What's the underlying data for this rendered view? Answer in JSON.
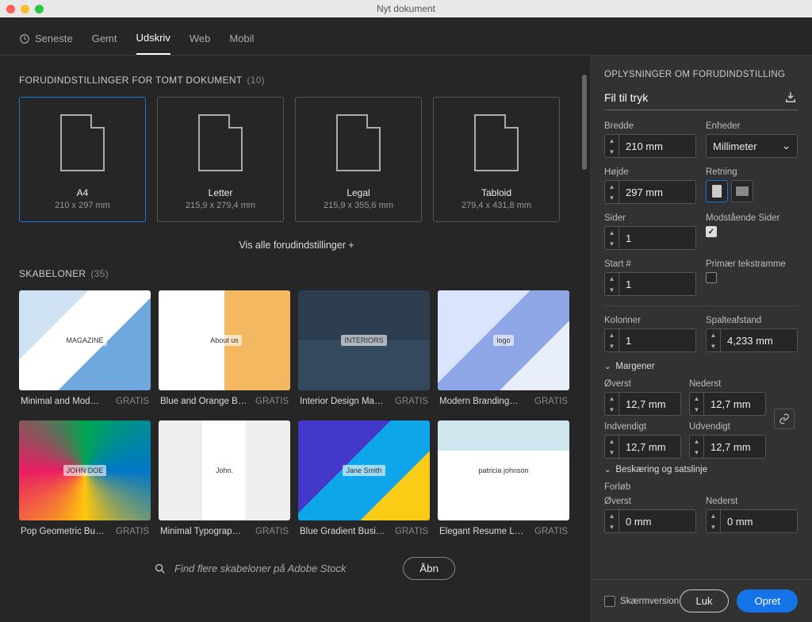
{
  "window": {
    "title": "Nyt dokument"
  },
  "tabs": [
    {
      "label": "Seneste",
      "active": false,
      "icon": true
    },
    {
      "label": "Gemt",
      "active": false
    },
    {
      "label": "Udskriv",
      "active": true
    },
    {
      "label": "Web",
      "active": false
    },
    {
      "label": "Mobil",
      "active": false
    }
  ],
  "presetSection": {
    "title": "FORUDINDSTILLINGER FOR TOMT DOKUMENT",
    "count": "(10)"
  },
  "presets": [
    {
      "name": "A4",
      "dim": "210 x 297 mm",
      "active": true
    },
    {
      "name": "Letter",
      "dim": "215,9 x 279,4 mm",
      "active": false
    },
    {
      "name": "Legal",
      "dim": "215,9 x 355,6 mm",
      "active": false
    },
    {
      "name": "Tabloid",
      "dim": "279,4 x 431,8 mm",
      "active": false
    }
  ],
  "viewAll": "Vis alle forudindstillinger",
  "templatesSection": {
    "title": "SKABELONER",
    "count": "(35)"
  },
  "templates": [
    {
      "title": "Minimal and Mod…",
      "badge": "GRATIS",
      "thumbLabel": "MAGAZINE"
    },
    {
      "title": "Blue and Orange B…",
      "badge": "GRATIS",
      "thumbLabel": "About us"
    },
    {
      "title": "Interior Design Ma…",
      "badge": "GRATIS",
      "thumbLabel": "INTERIORS"
    },
    {
      "title": "Modern Branding…",
      "badge": "GRATIS",
      "thumbLabel": "logo"
    },
    {
      "title": "Pop Geometric Bu…",
      "badge": "GRATIS",
      "thumbLabel": "JOHN DOE"
    },
    {
      "title": "Minimal Typograp…",
      "badge": "GRATIS",
      "thumbLabel": "John."
    },
    {
      "title": "Blue Gradient Busi…",
      "badge": "GRATIS",
      "thumbLabel": "Jane Smith"
    },
    {
      "title": "Elegant Resume L…",
      "badge": "GRATIS",
      "thumbLabel": "patricia johnson"
    }
  ],
  "search": {
    "placeholder": "Find flere skabeloner på Adobe Stock",
    "openLabel": "Åbn"
  },
  "details": {
    "title": "OPLYSNINGER OM FORUDINDSTILLING",
    "presetName": "Fil til tryk",
    "widthLabel": "Bredde",
    "width": "210 mm",
    "unitsLabel": "Enheder",
    "units": "Millimeter",
    "heightLabel": "Højde",
    "height": "297 mm",
    "orientationLabel": "Retning",
    "pagesLabel": "Sider",
    "pages": "1",
    "facingLabel": "Modstående Sider",
    "facingChecked": true,
    "startLabel": "Start #",
    "start": "1",
    "primaryFrameLabel": "Primær tekstramme",
    "primaryFrameChecked": false,
    "columnsLabel": "Kolonner",
    "columns": "1",
    "gutterLabel": "Spalteafstand",
    "gutter": "4,233 mm",
    "marginsSection": "Margener",
    "topLabel": "Øverst",
    "top": "12,7 mm",
    "bottomLabel": "Nederst",
    "bottom": "12,7 mm",
    "insideLabel": "Indvendigt",
    "inside": "12,7 mm",
    "outsideLabel": "Udvendigt",
    "outside": "12,7 mm",
    "bleedSection": "Beskæring og satslinje",
    "bleedLabel": "Forløb",
    "bleedTopLabel": "Øverst",
    "bleedTop": "0 mm",
    "bleedBottomLabel": "Nederst",
    "bleedBottom": "0 mm"
  },
  "footer": {
    "previewLabel": "Skærmversion",
    "closeLabel": "Luk",
    "createLabel": "Opret"
  }
}
